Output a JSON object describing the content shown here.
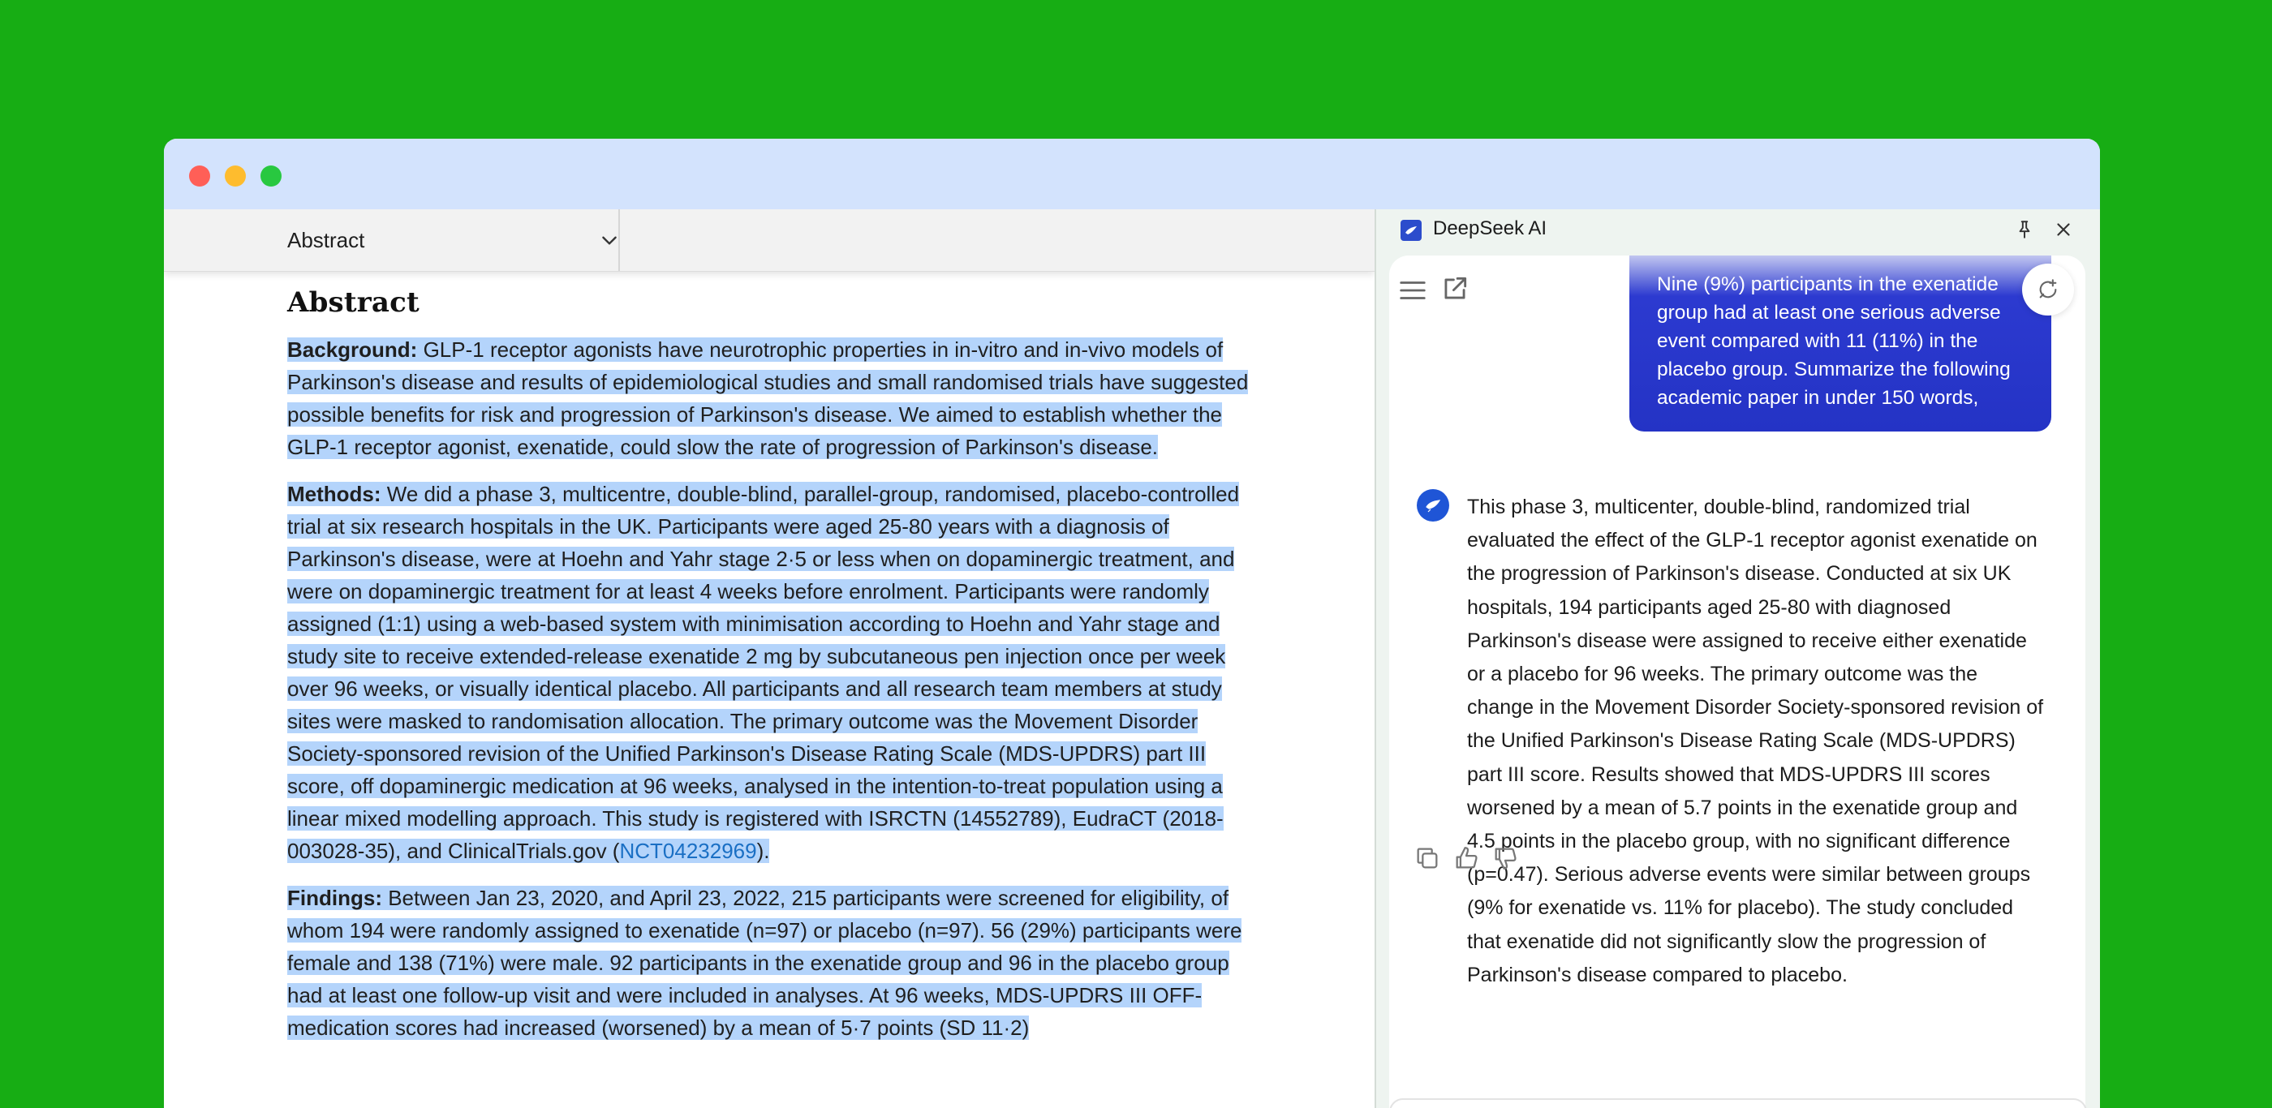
{
  "window": {
    "controls": [
      "close",
      "minimize",
      "zoom"
    ]
  },
  "doc": {
    "section_select": "Abstract",
    "heading": "Abstract",
    "background": {
      "label": "Background:",
      "text": "GLP-1 receptor agonists have neurotrophic properties in in-vitro and in-vivo models of Parkinson's disease and results of epidemiological studies and small randomised trials have suggested possible benefits for risk and progression of Parkinson's disease. We aimed to establish whether the GLP-1 receptor agonist, exenatide, could slow the rate of progression of Parkinson's disease."
    },
    "methods": {
      "label": "Methods:",
      "text": "We did a phase 3, multicentre, double-blind, parallel-group, randomised, placebo-controlled trial at six research hospitals in the UK. Participants were aged 25-80 years with a diagnosis of Parkinson's disease, were at Hoehn and Yahr stage 2·5 or less when on dopaminergic treatment, and were on dopaminergic treatment for at least 4 weeks before enrolment. Participants were randomly assigned (1:1) using a web-based system with minimisation according to Hoehn and Yahr stage and study site to receive extended-release exenatide 2 mg by subcutaneous pen injection once per week over 96 weeks, or visually identical placebo. All participants and all research team members at study sites were masked to randomisation allocation. The primary outcome was the Movement Disorder Society-sponsored revision of the Unified Parkinson's Disease Rating Scale (MDS-UPDRS) part III score, off dopaminergic medication at 96 weeks, analysed in the intention-to-treat population using a linear mixed modelling approach. This study is registered with ISRCTN (14552789), EudraCT (2018-003028-35), and ClinicalTrials.gov (",
      "link": "NCT04232969",
      "tail": ")."
    },
    "findings": {
      "label": "Findings:",
      "text": "Between Jan 23, 2020, and April 23, 2022, 215 participants were screened for eligibility, of whom 194 were randomly assigned to exenatide (n=97) or placebo (n=97). 56 (29%) participants were female and 138 (71%) were male. 92 participants in the exenatide group and 96 in the placebo group had at least one follow-up visit and were included in analyses. At 96 weeks, MDS-UPDRS III OFF-medication scores had increased (worsened) by a mean of 5·7 points (SD 11·2)"
    }
  },
  "panel": {
    "title": "DeepSeek AI",
    "user_message": "Nine (9%) participants in the exenatide group had at least one serious adverse event compared with 11 (11%) in the placebo group. Summarize the following academic paper in under 150 words,",
    "ai_response": "This phase 3, multicenter, double-blind, randomized trial evaluated the effect of the GLP-1 receptor agonist exenatide on the progression of Parkinson's disease. Conducted at six UK hospitals, 194 participants aged 25-80 with diagnosed Parkinson's disease were assigned to receive either exenatide or a placebo for 96 weeks. The primary outcome was the change in the Movement Disorder Society-sponsored revision of the Unified Parkinson's Disease Rating Scale (MDS-UPDRS) part III score. Results showed that MDS-UPDRS III scores worsened by a mean of 5.7 points in the exenatide group and 4.5 points in the placebo group, with no significant difference (p=0.47). Serious adverse events were similar between groups (9% for exenatide vs. 11% for placebo). The study concluded that exenatide did not significantly slow the progression of Parkinson's disease compared to placebo."
  },
  "colors": {
    "desktop": "#17ad14",
    "titlebar": "#d3e3fd",
    "selection": "#b4d4fb",
    "user_bubble": "#2433c5",
    "link": "#1a6fc4"
  },
  "icons": [
    "chevron-down-icon",
    "deepseek-logo-icon",
    "pin-icon",
    "close-icon",
    "menu-icon",
    "open-external-icon",
    "new-chat-icon",
    "copy-icon",
    "thumbs-up-icon",
    "thumbs-down-icon"
  ]
}
